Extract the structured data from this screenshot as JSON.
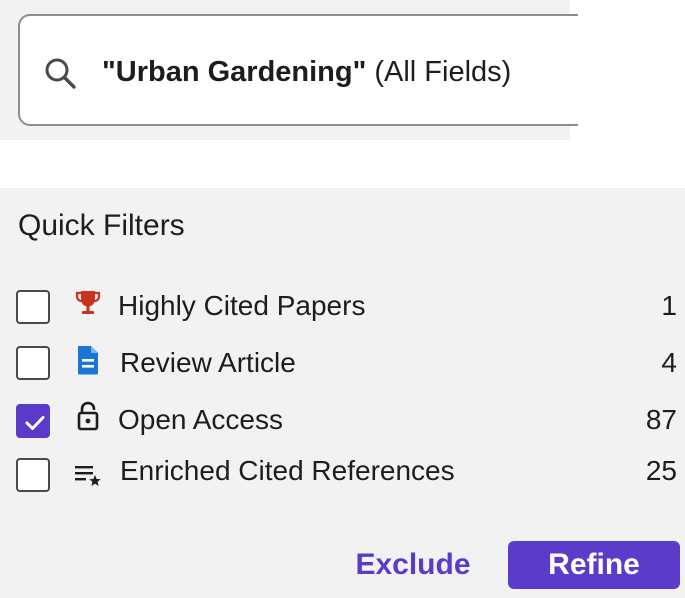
{
  "search": {
    "query": "\"Urban Gardening\"",
    "field": "(All Fields)",
    "icon": "search-icon"
  },
  "quick_filters": {
    "title": "Quick Filters",
    "items": [
      {
        "label": "Highly Cited Papers",
        "count": "1",
        "checked": false,
        "icon": "trophy-icon",
        "icon_color": "#c8321e"
      },
      {
        "label": "Review Article",
        "count": "4",
        "checked": false,
        "icon": "document-icon",
        "icon_color": "#1976d2"
      },
      {
        "label": "Open Access",
        "count": "87",
        "checked": true,
        "icon": "unlock-icon",
        "icon_color": "#1d1d1f"
      },
      {
        "label": "Enriched Cited References",
        "count": "25",
        "checked": false,
        "icon": "list-star-icon",
        "icon_color": "#1d1d1f"
      }
    ],
    "exclude_label": "Exclude",
    "refine_label": "Refine"
  },
  "colors": {
    "accent": "#5b3bc9",
    "panel_bg": "#f2f2f2"
  }
}
